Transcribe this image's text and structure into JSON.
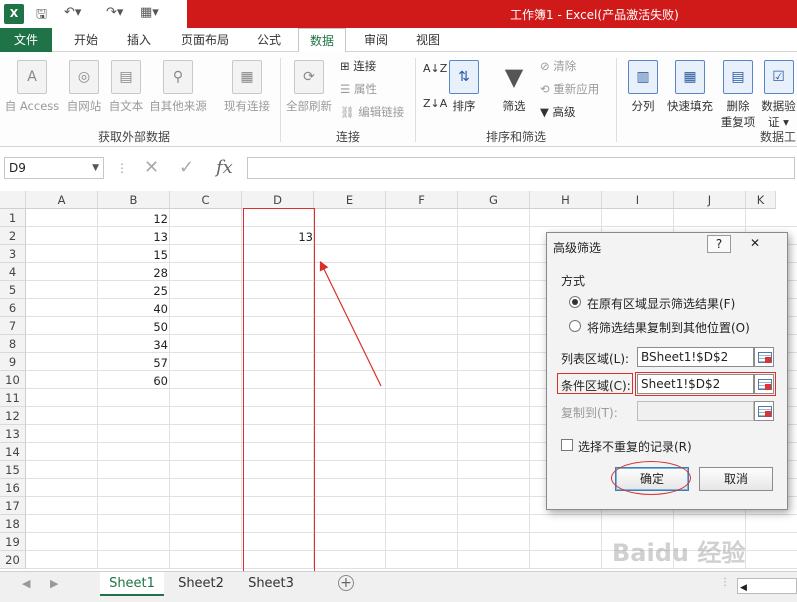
{
  "window": {
    "title": "工作簿1 - Excel(产品激活失败)"
  },
  "ribbon_tabs": [
    "文件",
    "开始",
    "插入",
    "页面布局",
    "公式",
    "数据",
    "审阅",
    "视图"
  ],
  "ribbon": {
    "get_external": {
      "access": "自 Access",
      "web": "自网站",
      "text": "自文本",
      "other": "自其他来源",
      "existing": "现有连接",
      "group": "获取外部数据"
    },
    "connections": {
      "refresh": "全部刷新",
      "connect": "连接",
      "props": "属性",
      "edit": "编辑链接",
      "group": "连接"
    },
    "sort": {
      "az": "A↓Z",
      "sort": "排序",
      "filter": "筛选",
      "clear": "清除",
      "reapply": "重新应用",
      "advanced": "高级",
      "group": "排序和筛选"
    },
    "tools": {
      "split": "分列",
      "flash": "快速填充",
      "dedupe_line1": "删除",
      "dedupe_line2": "重复项",
      "valid_line1": "数据验",
      "valid_line2": "证 ▾",
      "group": "数据工"
    }
  },
  "formula_bar": {
    "name_box": "D9",
    "fx": "fx"
  },
  "columns": [
    "A",
    "B",
    "C",
    "D",
    "E",
    "F",
    "G",
    "H",
    "I",
    "J",
    "K"
  ],
  "rows": [
    "1",
    "2",
    "3",
    "4",
    "5",
    "6",
    "7",
    "8",
    "9",
    "10",
    "11",
    "12",
    "13",
    "14",
    "15",
    "16",
    "17",
    "18",
    "19",
    "20"
  ],
  "cells": {
    "B": [
      "12",
      "13",
      "15",
      "28",
      "25",
      "40",
      "50",
      "34",
      "57",
      "60"
    ],
    "D2": "13"
  },
  "sheets": [
    "Sheet1",
    "Sheet2",
    "Sheet3"
  ],
  "dialog": {
    "title": "高级筛选",
    "help": "?",
    "close": "✕",
    "method_label": "方式",
    "option1": "在原有区域显示筛选结果(F)",
    "option2": "将筛选结果复制到其他位置(O)",
    "list_range_label": "列表区域(L):",
    "list_range_value": "BSheet1!$D$2",
    "criteria_label": "条件区域(C):",
    "criteria_value": "Sheet1!$D$2",
    "copy_to_label": "复制到(T):",
    "unique_label": "选择不重复的记录(R)",
    "ok": "确定",
    "cancel": "取消"
  },
  "watermark": "Baidu 经验",
  "colors": {
    "accent": "#1f7346",
    "title_red": "#d01a1a",
    "annotation_red": "#d9302c"
  }
}
